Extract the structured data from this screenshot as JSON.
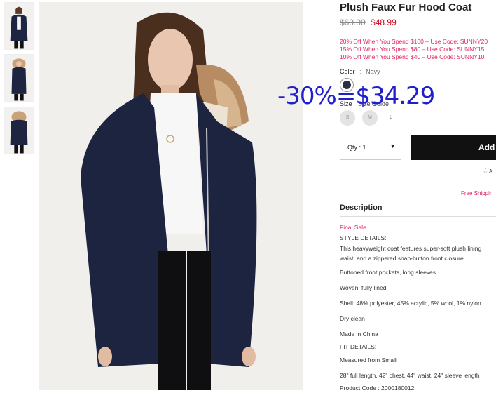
{
  "product": {
    "title": "Plush Faux Fur Hood Coat",
    "price_original": "$69.90",
    "price_sale": "$48.99",
    "promos": [
      "20% Off When You Spend $100 – Use Code: SUNNY20",
      "15% Off When You Spend $80 – Use Code: SUNNY15",
      "10% Off When You Spend $40 – Use Code: SUNNY10"
    ],
    "color_label": "Color",
    "color_sep": ":",
    "color_value": "Navy",
    "size_label": "Size",
    "size_guide": "Size Guide",
    "sizes": [
      "S",
      "M",
      "L"
    ],
    "qty_text": "Qty :  1",
    "add_label": "Add",
    "wishlist_label": "A",
    "shipping_text": "Free Shippin",
    "description_title": "Description",
    "description": {
      "final_sale": "Final Sale",
      "style_header": "STYLE DETAILS:",
      "style_lines": [
        "This heavyweight coat features super-soft plush lining",
        "waist, and a zippered snap-button front closure."
      ],
      "details": [
        "Buttoned front pockets, long sleeves",
        "Woven, fully lined",
        "Shell: 48% polyester, 45% acrylic, 5% wool, 1% nylon",
        "Dry clean",
        "Made in China"
      ],
      "fit_header": "FIT DETAILS:",
      "fit_lines": [
        "Measured from Small",
        "28\" full length, 42\" chest, 44\" waist, 24\" sleeve length"
      ],
      "product_code": "Product Code : 2000180012"
    }
  },
  "overlay": {
    "text": "-30%=$34.29",
    "color": "#1f1fcc"
  },
  "colors": {
    "sale_red": "#d0021b",
    "promo_pink": "#e0245e",
    "swatch_navy": "#2b2f45",
    "button_black": "#111111"
  },
  "icons": {
    "caret": "caret-down-icon",
    "heart": "heart-icon"
  }
}
